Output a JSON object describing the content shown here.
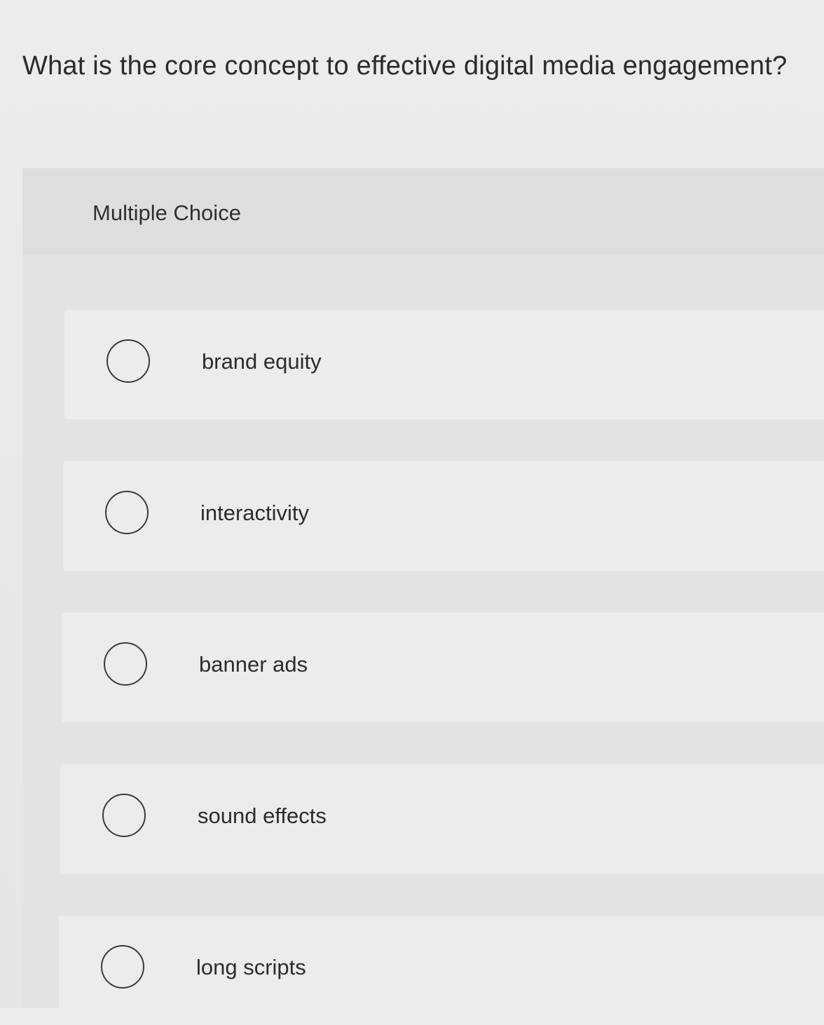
{
  "question": {
    "text": "What is the core concept to effective digital media engagement?"
  },
  "multiple_choice": {
    "label": "Multiple Choice",
    "options": [
      {
        "label": "brand equity",
        "selected": false
      },
      {
        "label": "interactivity",
        "selected": false
      },
      {
        "label": "banner ads",
        "selected": false
      },
      {
        "label": "sound effects",
        "selected": false
      },
      {
        "label": "long scripts",
        "selected": false
      }
    ]
  }
}
